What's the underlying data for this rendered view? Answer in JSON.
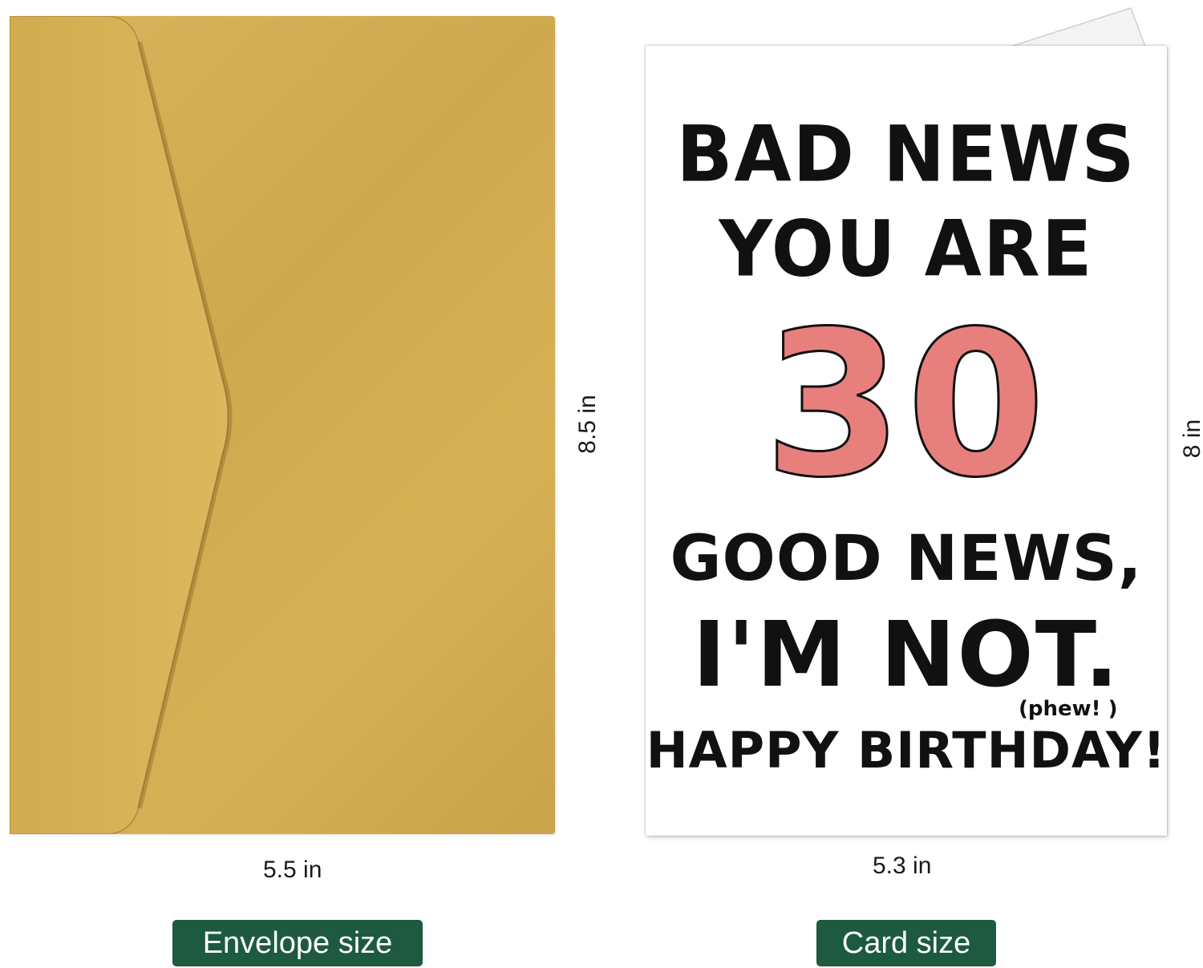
{
  "envelope": {
    "width_label": "5.5 in",
    "height_label": "8.5 in",
    "caption": "Envelope size",
    "color": "#d4af53"
  },
  "card": {
    "width_label": "5.3 in",
    "height_label": "8 in",
    "caption": "Card size",
    "lines": {
      "line1": "BAD NEWS",
      "line2": "YOU ARE",
      "age": "30",
      "line3": "GOOD NEWS,",
      "line4": "I'M NOT.",
      "aside": "(phew! )",
      "line5": "HAPPY BIRTHDAY!"
    },
    "age_color": "#e7807d"
  },
  "caption_color": "#1d5a3f"
}
